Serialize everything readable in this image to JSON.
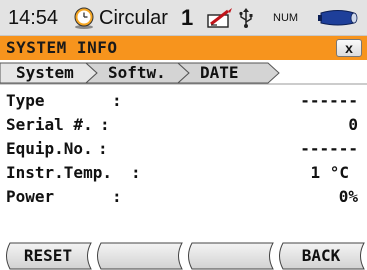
{
  "status": {
    "time": "14:54",
    "mode": "Circular",
    "face": "1",
    "num": "NUM"
  },
  "window": {
    "title": "SYSTEM INFO",
    "close": "x"
  },
  "tabs": [
    {
      "label": "System",
      "active": true
    },
    {
      "label": "Softw.",
      "active": false
    },
    {
      "label": "DATE",
      "active": false
    }
  ],
  "fields": [
    {
      "label": "Type",
      "sep": ":",
      "value": "------"
    },
    {
      "label": "Serial #.",
      "sep": ":",
      "value": "0"
    },
    {
      "label": "Equip.No.",
      "sep": ":",
      "value": "------"
    },
    {
      "label": "Instr.Temp.",
      "sep": ":",
      "value": "1 °C"
    },
    {
      "label": "Power",
      "sep": ":",
      "value": "0%"
    }
  ],
  "softkeys": [
    {
      "label": "RESET"
    },
    {
      "label": ""
    },
    {
      "label": ""
    },
    {
      "label": "BACK"
    }
  ],
  "icons": [
    "clock-icon",
    "face-indicator",
    "pen-icon",
    "usb-icon",
    "battery-icon",
    "close-icon"
  ],
  "colors": {
    "title_bar": "#f7941d",
    "status_bar": "#e3e3e3",
    "clock_face": "#f5a623"
  }
}
